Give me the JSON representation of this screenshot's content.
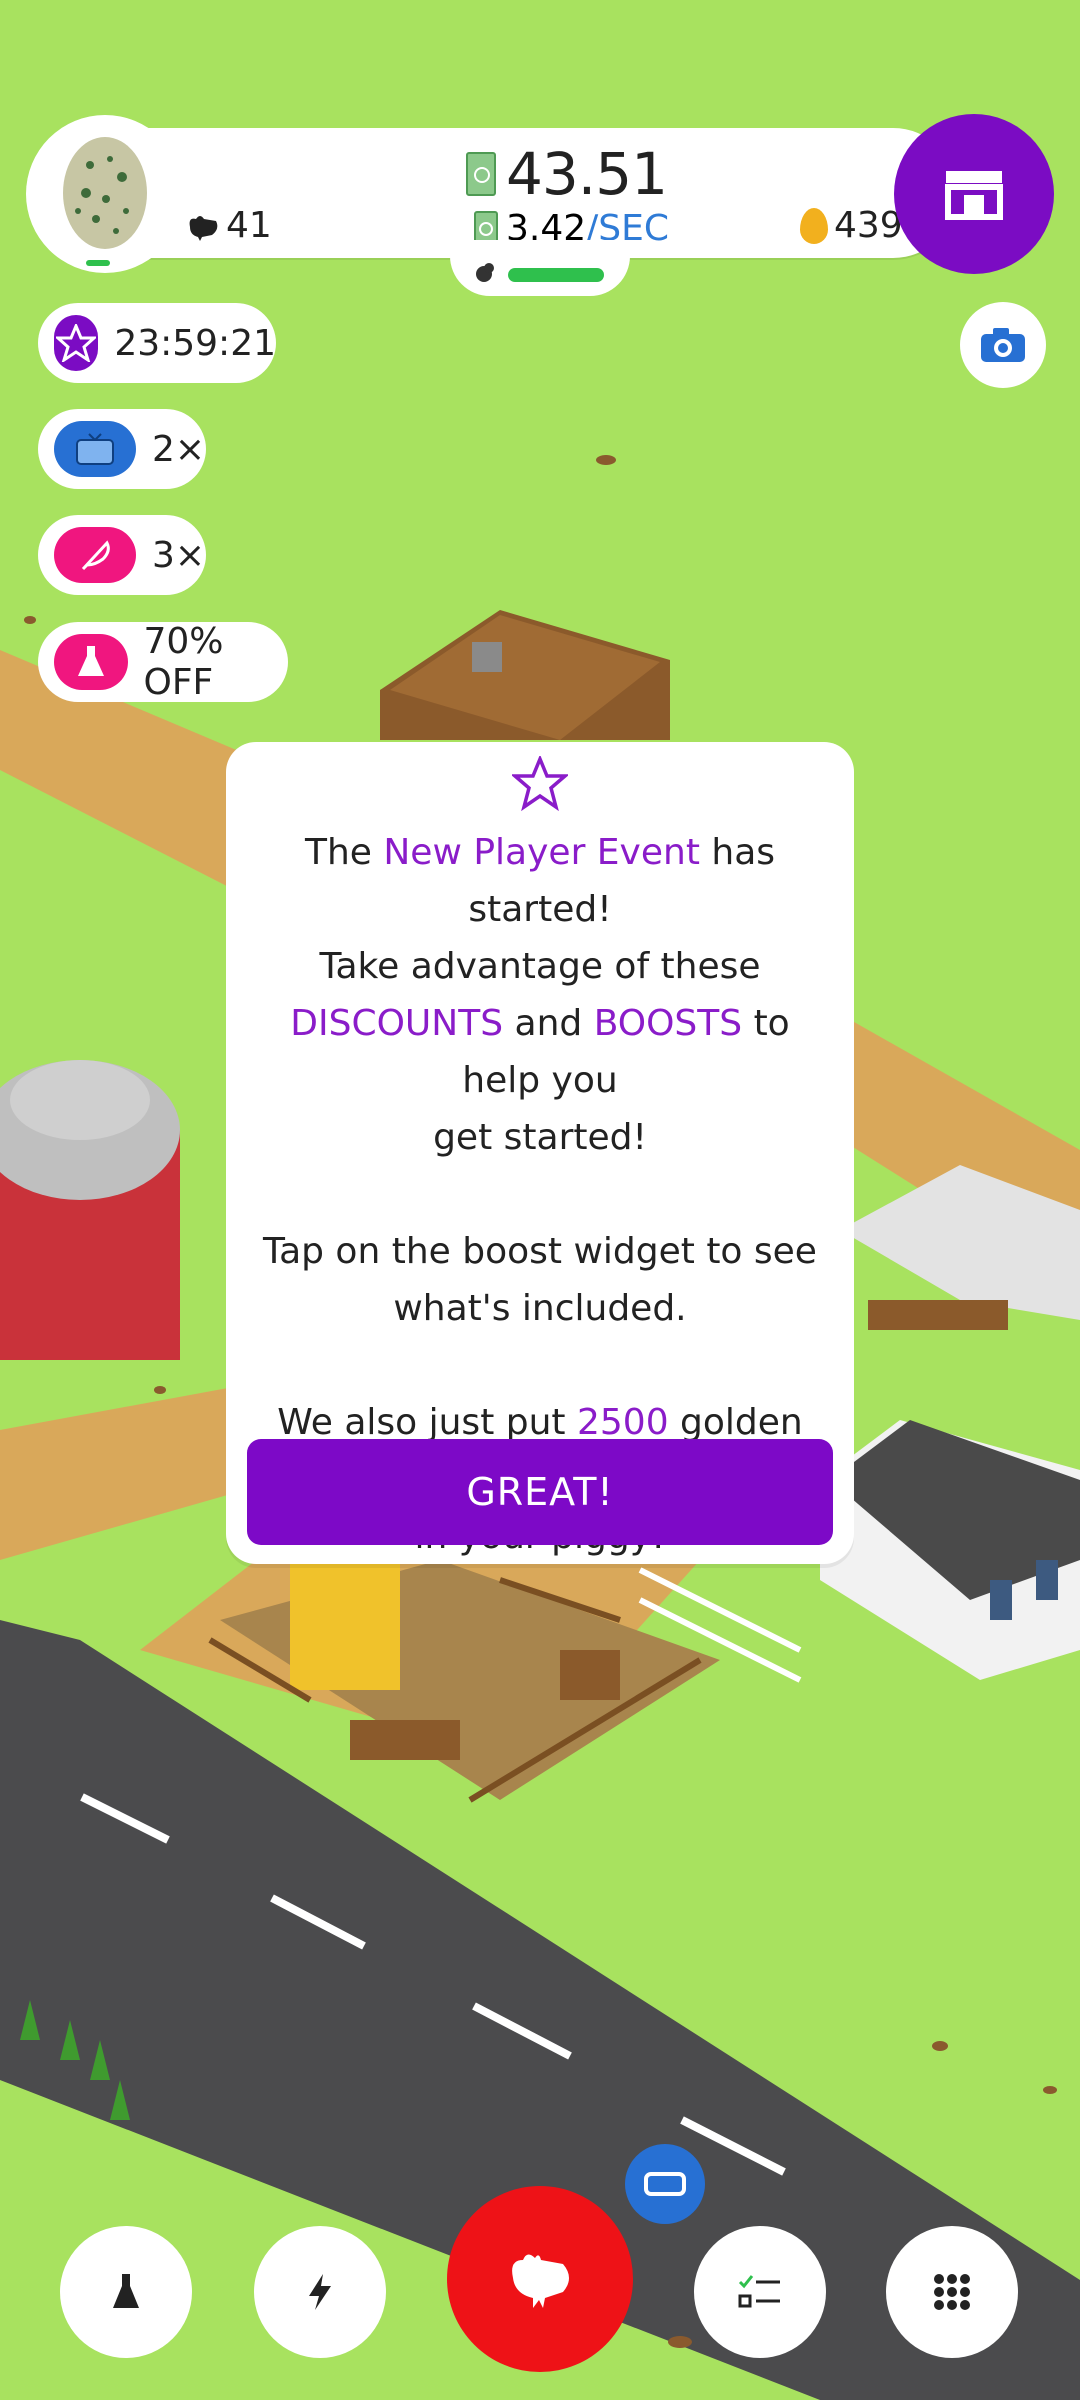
{
  "hud": {
    "chicken_count": "41",
    "cash": "43.51",
    "rate_value": "3.42",
    "rate_unit": "/SEC",
    "golden_eggs": "439"
  },
  "boosts": [
    {
      "icon": "star-icon",
      "label": "23:59:21"
    },
    {
      "icon": "tv-icon",
      "label": "2×"
    },
    {
      "icon": "quill-icon",
      "label": "3×"
    },
    {
      "icon": "flask-icon",
      "label": "70% OFF"
    }
  ],
  "popup": {
    "line1_pre": "The ",
    "line1_event": "New Player Event",
    "line1_post": " has started!",
    "line2": "Take advantage of these",
    "line3_discounts": "DISCOUNTS",
    "line3_and": " and ",
    "line3_boosts": "BOOSTS",
    "line3_post": " to help you",
    "line4": "get started!",
    "line5": "Tap on the boost widget to see",
    "line6": "what's included.",
    "line7_pre": "We also just put ",
    "line7_num": "2500",
    "line7_post": " golden eggs",
    "line8": "in your piggy!",
    "button": "GREAT!"
  },
  "colors": {
    "grass": "#a8e25f",
    "purple": "#7d09c7",
    "red": "#ee1217",
    "blue": "#2f7bd6",
    "pink": "#f0167f"
  }
}
